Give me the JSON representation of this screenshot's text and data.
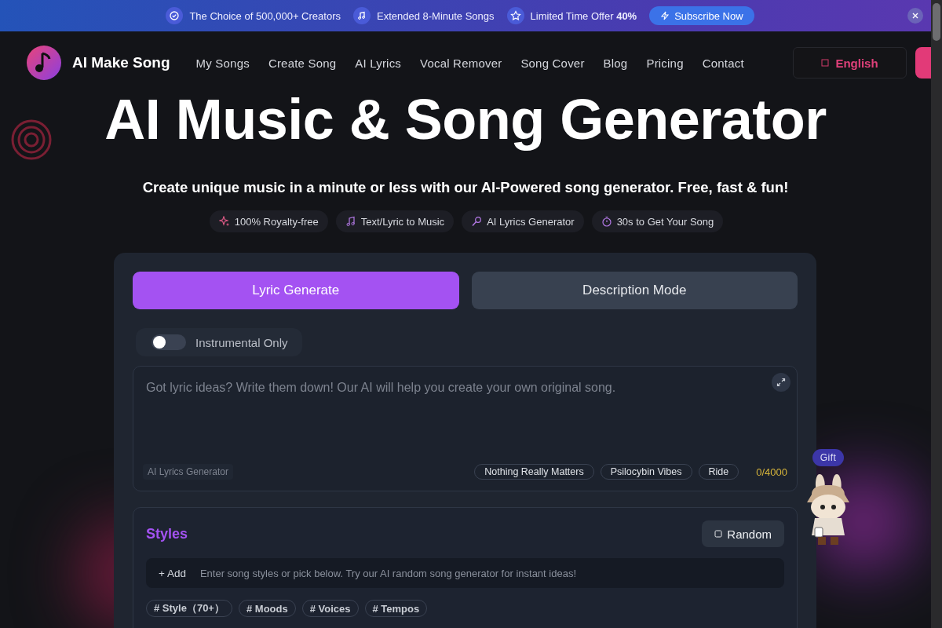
{
  "banner": {
    "items": [
      {
        "kind": "check",
        "text": "The Choice of 500,000+ Creators"
      },
      {
        "kind": "music",
        "text": "Extended 8-Minute Songs"
      },
      {
        "kind": "star",
        "text": "Limited Time Offer **40%**"
      }
    ],
    "subscribe": "Subscribe Now"
  },
  "nav": {
    "brand": "AI Make Song",
    "links": [
      "My Songs",
      "Create Song",
      "AI Lyrics",
      "Vocal Remover",
      "Song Cover",
      "Blog",
      "Pricing",
      "Contact"
    ],
    "language": "English"
  },
  "hero": {
    "title": "AI Music & Song Generator",
    "subtitle": "Create unique music in a minute or less with our AI-Powered song generator. Free, fast & fun!",
    "features": [
      {
        "kind": "sparkle",
        "text": "100% Royalty-free"
      },
      {
        "kind": "music",
        "text": "Text/Lyric to Music"
      },
      {
        "kind": "mic",
        "text": "AI Lyrics Generator"
      },
      {
        "kind": "timer",
        "text": "30s to Get Your Song"
      }
    ]
  },
  "generator": {
    "tabs": [
      {
        "label": "Lyric Generate",
        "selected": true
      },
      {
        "label": "Description Mode",
        "selected": false
      }
    ],
    "instrumental": {
      "label": "Instrumental Only",
      "on": false
    },
    "lyrics": {
      "placeholder": "Got lyric ideas? Write them down! Our AI will help you create your own original song.",
      "generator_link": "AI Lyrics Generator",
      "suggestions": [
        "Nothing Really Matters",
        "Psilocybin Vibes",
        "Ride"
      ],
      "counter": "0/4000"
    },
    "styles": {
      "title": "Styles",
      "random": "Random",
      "add": "+ Add",
      "placeholder": "Enter song styles or pick below. Try our AI random song generator for instant ideas!",
      "categories": [
        "# Style（70+）",
        "# Moods",
        "# Voices",
        "# Tempos"
      ]
    }
  },
  "gift": {
    "label": "Gift"
  }
}
